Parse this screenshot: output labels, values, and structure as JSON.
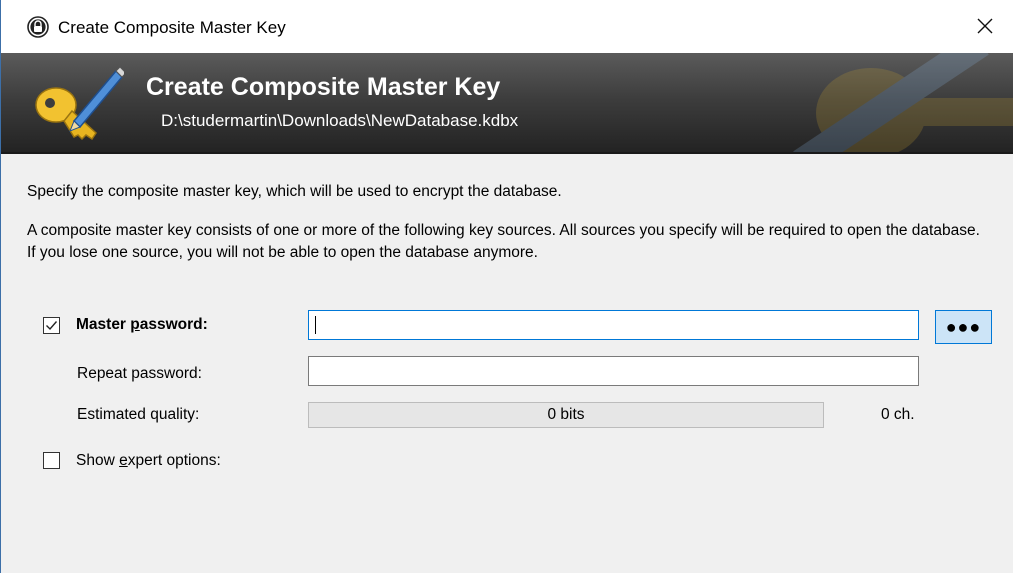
{
  "window": {
    "title": "Create Composite Master Key",
    "close_icon": "close-icon"
  },
  "banner": {
    "title": "Create Composite Master Key",
    "subtitle": "D:\\studermartin\\Downloads\\NewDatabase.kdbx",
    "icon": "key-pencil-icon"
  },
  "description": {
    "line1": "Specify the composite master key, which will be used to encrypt the database.",
    "line2": "A composite master key consists of one or more of the following key sources. All sources you specify will be required to open the database. If you lose one source, you will not be able to open the database anymore."
  },
  "master_password": {
    "checked": true,
    "label_pre": "Master ",
    "label_underlined": "p",
    "label_post": "assword:",
    "value": "",
    "toggle_label": "●●●"
  },
  "repeat_password": {
    "label": "Repeat password:",
    "value": ""
  },
  "quality": {
    "label": "Estimated quality:",
    "bits_text": "0 bits",
    "fill_fraction": 0,
    "chars_text": "0 ch."
  },
  "expert_options": {
    "checked": false,
    "label_pre": "Show ",
    "label_underlined": "e",
    "label_post": "xpert options:"
  },
  "colors": {
    "accent": "#0078d7",
    "banner_dark": "#222222",
    "dialog_bg": "#f0f0f0"
  }
}
